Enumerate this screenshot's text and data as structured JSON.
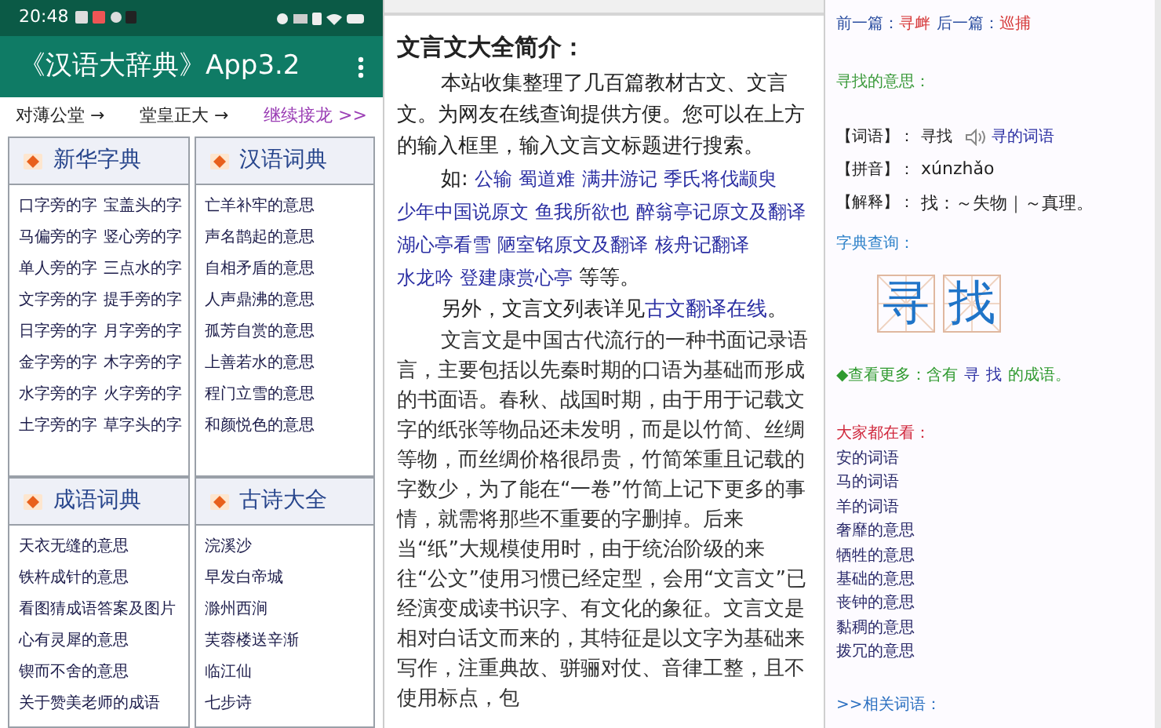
{
  "left_app": {
    "status_bar": {
      "time": "20:48"
    },
    "header": {
      "title": "《汉语大辞典》App3.2"
    },
    "chain_links": [
      {
        "text": "对薄公堂 →",
        "kind": "word"
      },
      {
        "text": "堂皇正大 →",
        "kind": "word"
      },
      {
        "text": "继续接龙 >>",
        "kind": "more"
      }
    ],
    "sections": [
      {
        "title": "新华字典",
        "kind": "pairs",
        "items": [
          "口字旁的字",
          "宝盖头的字",
          "马偏旁的字",
          "竖心旁的字",
          "单人旁的字",
          "三点水的字",
          "文字旁的字",
          "提手旁的字",
          "日字旁的字",
          "月字旁的字",
          "金字旁的字",
          "木字旁的字",
          "水字旁的字",
          "火字旁的字",
          "土字旁的字",
          "草字头的字"
        ]
      },
      {
        "title": "汉语词典",
        "kind": "list",
        "items": [
          "亡羊补牢的意思",
          "声名鹊起的意思",
          "自相矛盾的意思",
          "人声鼎沸的意思",
          "孤芳自赏的意思",
          "上善若水的意思",
          "程门立雪的意思",
          "和颜悦色的意思"
        ]
      },
      {
        "title": "成语词典",
        "kind": "list",
        "items": [
          "天衣无缝的意思",
          "铁杵成针的意思",
          "看图猜成语答案及图片",
          "心有灵犀的意思",
          "锲而不舍的意思",
          "关于赞美老师的成语"
        ]
      },
      {
        "title": "古诗大全",
        "kind": "list",
        "items": [
          "浣溪沙",
          "早发白帝城",
          "滁州西涧",
          "芙蓉楼送辛渐",
          "临江仙",
          "七步诗"
        ]
      }
    ]
  },
  "middle_page": {
    "heading": "文言文大全简介：",
    "intro": "本站收集整理了几百篇教材古文、文言文。为网友在线查询提供方便。您可以在上方的输入框里，输入文言文标题进行搜索。",
    "examples_prefix": "如:",
    "examples": [
      "公输",
      "蜀道难",
      "满井游记",
      "季氏将伐颛臾",
      "少年中国说原文",
      "鱼我所欲也",
      "醉翁亭记原文及翻译",
      "湖心亭看雪",
      "陋室铭原文及翻译",
      "核舟记翻译",
      "水龙吟 登建康赏心亭"
    ],
    "examples_suffix": "等等。",
    "see_also_prefix": "另外，文言文列表详见",
    "see_also_link": "古文翻译在线",
    "see_also_suffix": "。",
    "body": "文言文是中国古代流行的一种书面记录语言，主要包括以先秦时期的口语为基础而形成的书面语。春秋、战国时期，由于用于记载文字的纸张等物品还未发明，而是以竹简、丝绸等物，而丝绸价格很昂贵，竹简笨重且记载的字数少，为了能在“一卷”竹简上记下更多的事情，就需将那些不重要的字删掉。后来当“纸”大规模使用时，由于统治阶级的来往“公文”使用习惯已经定型，会用“文言文”已经演变成读书识字、有文化的象征。文言文是相对白话文而来的，其特征是以文字为基础来写作，注重典故、骈骊对仗、音律工整，且不使用标点，包"
  },
  "right_page": {
    "prev_label": "前一篇：",
    "prev": "寻衅",
    "next_label": "后一篇：",
    "next": "巡捕",
    "meaning_title": "寻找的意思：",
    "entries": [
      {
        "label": "【词语】：",
        "value": "寻找",
        "kind": "word",
        "link": "寻的词语"
      },
      {
        "label": "【拼音】：",
        "value": "xúnzhǎo",
        "kind": "text"
      },
      {
        "label": "【解释】：",
        "value": "找：～失物｜～真理。",
        "kind": "text"
      }
    ],
    "dict_title": "字典查询：",
    "characters": [
      "寻",
      "找"
    ],
    "more_prefix": "◆查看更多：含有",
    "more_chars": [
      "寻",
      "找"
    ],
    "more_suffix": "的成语。",
    "popular_title": "大家都在看：",
    "popular": [
      "安的词语",
      "马的词语",
      "羊的词语",
      "奢靡的意思",
      "牺牲的意思",
      "基础的意思",
      "丧钟的意思",
      "黏稠的意思",
      "拨冗的意思"
    ],
    "related": ">>相关词语："
  }
}
